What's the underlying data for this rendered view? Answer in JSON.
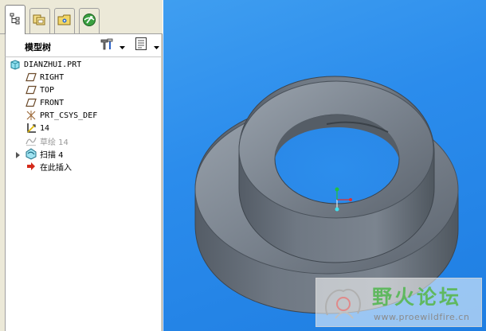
{
  "panel": {
    "tabs": [
      {
        "name": "model-tree-tab",
        "icon": "tree-hierarchy-icon",
        "active": true
      },
      {
        "name": "folder-browser-tab",
        "icon": "folder-browser-icon",
        "active": false
      },
      {
        "name": "favorites-tab",
        "icon": "favorites-folder-icon",
        "active": false
      },
      {
        "name": "connections-tab",
        "icon": "web-globe-icon",
        "active": false
      }
    ],
    "tree_title": "模型树",
    "tools": [
      "settings-hammer-icon",
      "show-menu-icon"
    ]
  },
  "tree": {
    "items": [
      {
        "label": "DIANZHUI.PRT",
        "icon": "part-cube-icon",
        "dim": false
      },
      {
        "label": "RIGHT",
        "icon": "datum-plane-icon",
        "dim": false
      },
      {
        "label": "TOP",
        "icon": "datum-plane-icon",
        "dim": false
      },
      {
        "label": "FRONT",
        "icon": "datum-plane-icon",
        "dim": false
      },
      {
        "label": "PRT_CSYS_DEF",
        "icon": "coordinate-system-icon",
        "dim": false
      },
      {
        "label": "14",
        "icon": "helix-sketch-icon",
        "dim": false
      },
      {
        "label": "草绘 14",
        "icon": "sketch-icon",
        "dim": true
      },
      {
        "label": "扫描 4",
        "icon": "sweep-feature-icon",
        "dim": false
      },
      {
        "label": "在此插入",
        "icon": "insert-here-arrow-icon",
        "dim": false
      }
    ]
  },
  "watermark": {
    "title": "野火论坛",
    "url": "www.proewildfire.cn"
  },
  "colors": {
    "viewport_blue": "#2b8cec",
    "model_grey": "#6b7580",
    "panel_bg": "#ece9d8"
  }
}
